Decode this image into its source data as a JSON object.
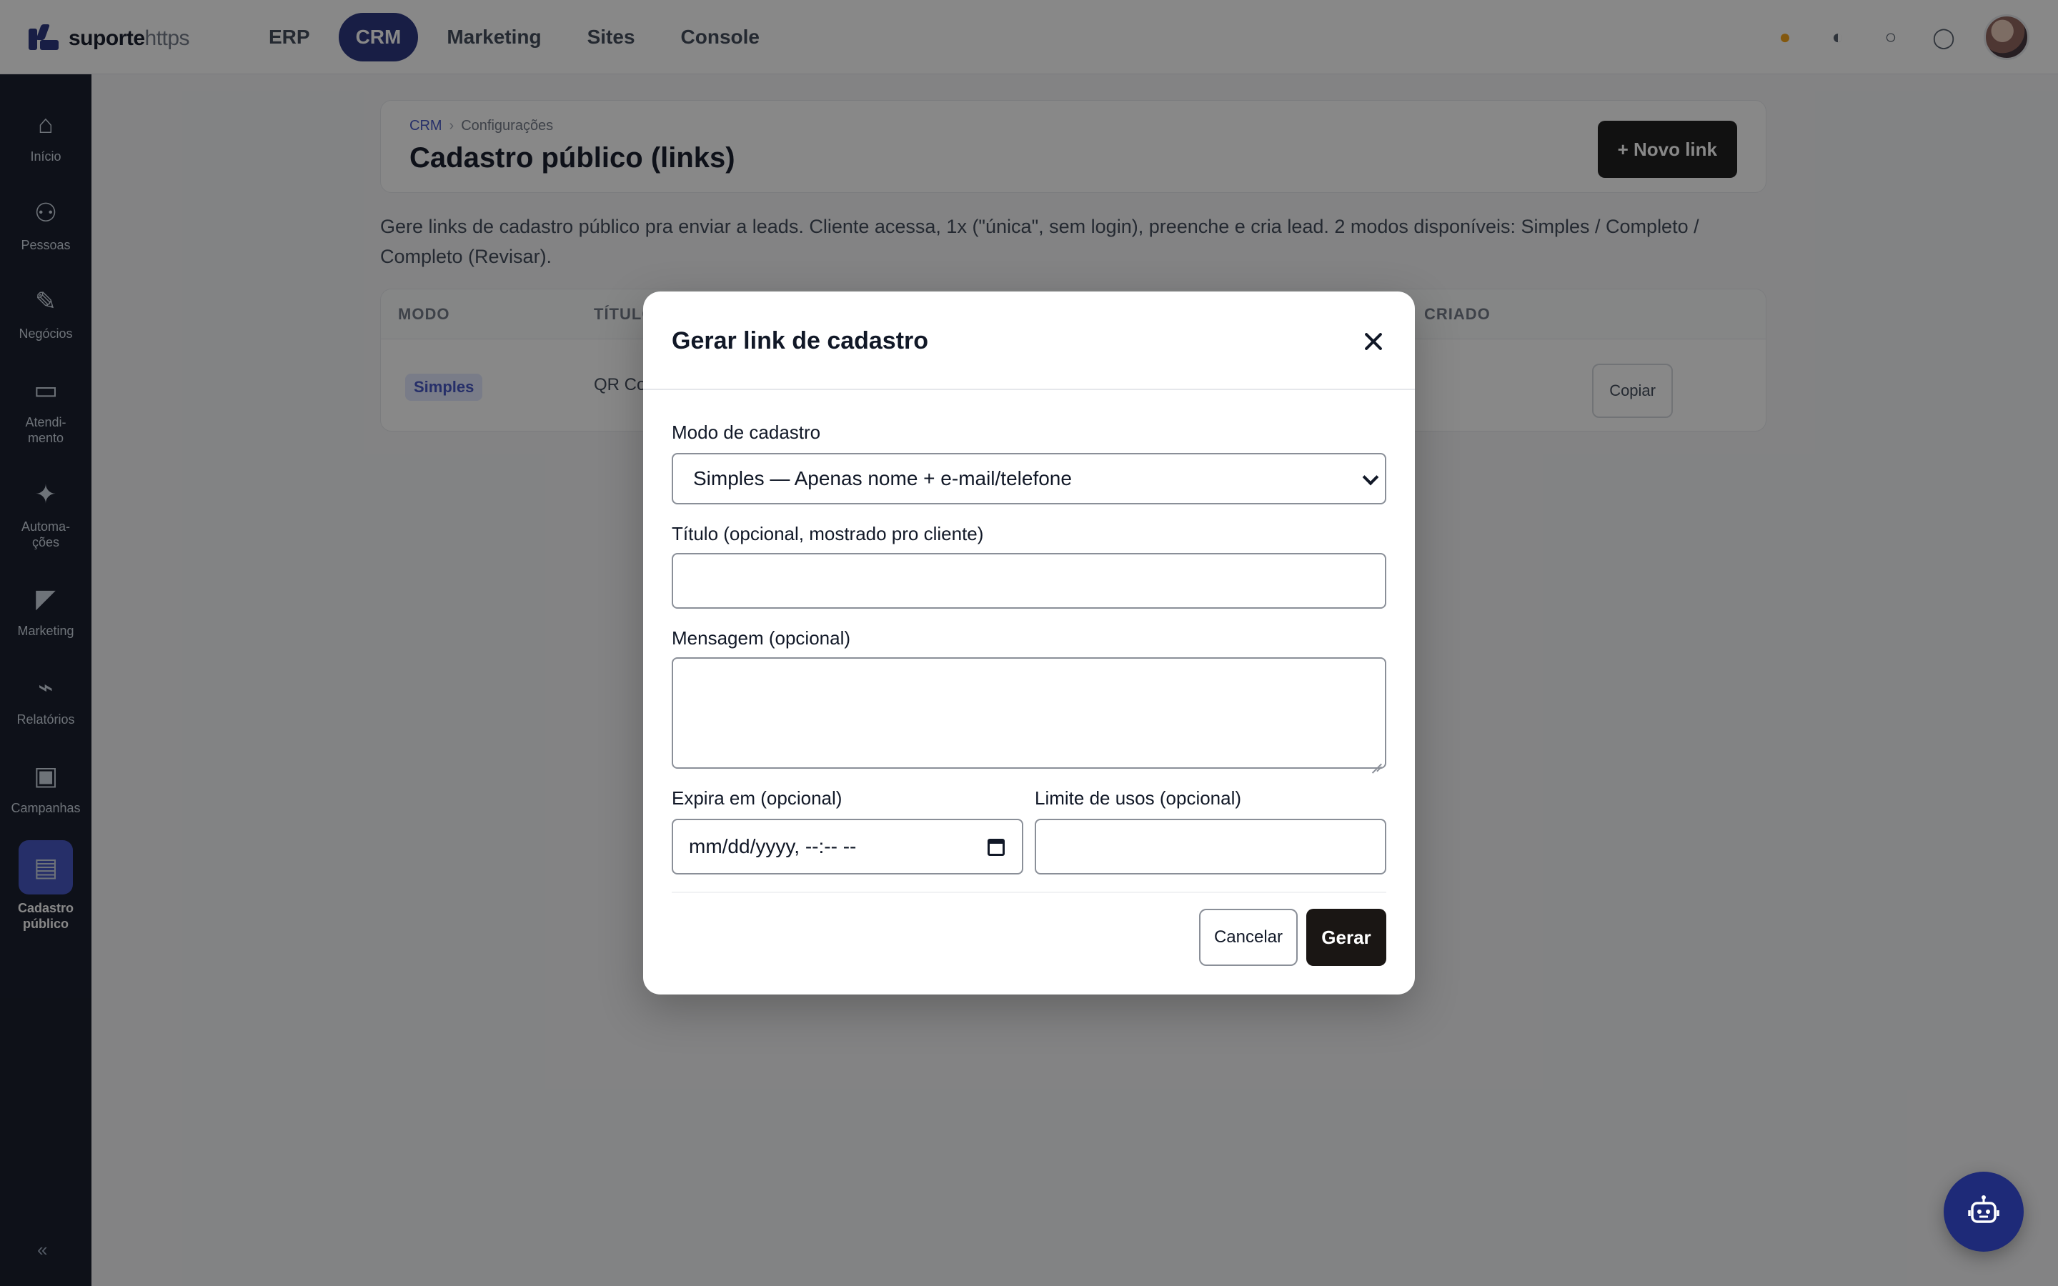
{
  "topbar": {
    "logo_bold": "suporte",
    "logo_light": "https",
    "nav": [
      {
        "label": "ERP",
        "active": false
      },
      {
        "label": "CRM",
        "active": true
      },
      {
        "label": "Marketing",
        "active": false
      },
      {
        "label": "Sites",
        "active": false
      },
      {
        "label": "Console",
        "active": false
      }
    ]
  },
  "sidebar": {
    "items": [
      {
        "label": "Início",
        "icon": "home-icon"
      },
      {
        "label": "Pessoas",
        "icon": "users-icon"
      },
      {
        "label": "Negócios",
        "icon": "deals-icon"
      },
      {
        "label": "Atendi-\nmento",
        "icon": "chat-icon"
      },
      {
        "label": "Automa-\nções",
        "icon": "automation-icon"
      },
      {
        "label": "Marketing",
        "icon": "megaphone-icon"
      },
      {
        "label": "Relatórios",
        "icon": "reports-icon"
      },
      {
        "label": "Campanhas",
        "icon": "campaign-icon"
      },
      {
        "label": "Cadastro\npúblico",
        "icon": "form-icon",
        "active": true
      }
    ]
  },
  "page": {
    "breadcrumb_root": "CRM",
    "breadcrumb_current": "Configurações",
    "title": "Cadastro público (links)",
    "new_link_button": "+ Novo link",
    "intro": "Gere links de cadastro público pra enviar a leads. Cliente acessa, 1x (\"única\", sem login), preenche e cria lead. 2 modos disponíveis: Simples / Completo / Completo (Revisar).",
    "table": {
      "headers": [
        "MODO",
        "TÍTULO",
        "",
        "",
        "",
        "CRIADO",
        ""
      ],
      "rows": [
        {
          "mode": "Simples",
          "title": "QR Code",
          "action": "Copiar"
        }
      ]
    }
  },
  "modal": {
    "title": "Gerar link de cadastro",
    "mode_label": "Modo de cadastro",
    "mode_value": "Simples — Apenas nome + e-mail/telefone",
    "title_label": "Título (opcional, mostrado pro cliente)",
    "title_value": "",
    "message_label": "Mensagem (opcional)",
    "message_value": "",
    "expires_label": "Expira em (opcional)",
    "expires_placeholder": "mm/dd/yyyy, --:-- --",
    "limit_label": "Limite de usos (opcional)",
    "limit_value": "",
    "cancel_label": "Cancelar",
    "generate_label": "Gerar"
  },
  "colors": {
    "brand": "#1e2a78",
    "sidebar_bg": "#0b1020",
    "primary_button": "#1a1614"
  }
}
